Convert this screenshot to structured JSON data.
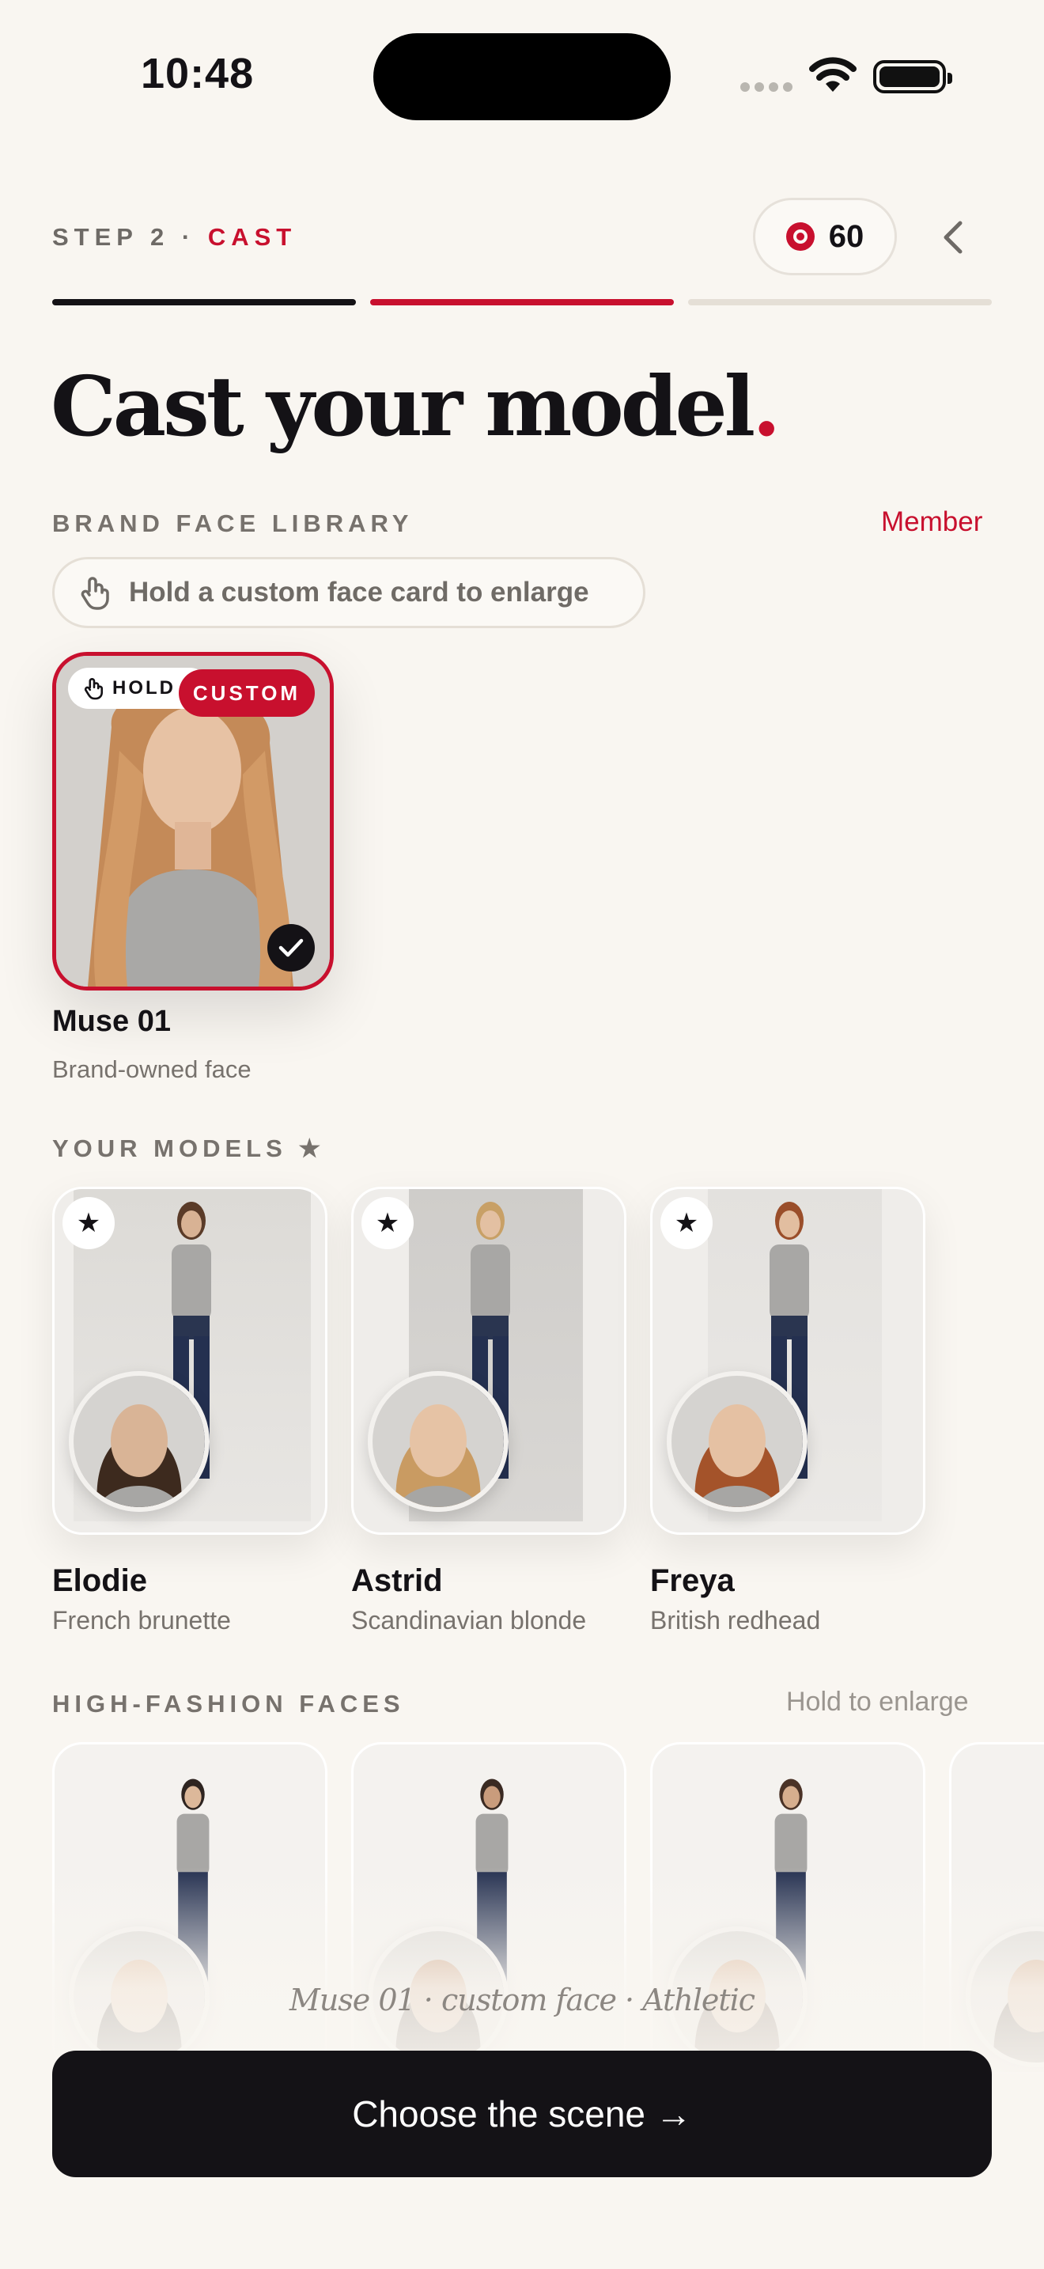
{
  "status_bar": {
    "time": "10:48"
  },
  "header": {
    "step_prefix": "STEP 2 · ",
    "step_name": "CAST",
    "credits": "60"
  },
  "title": {
    "text": "Cast your model",
    "dot": "."
  },
  "brand_library": {
    "label": "BRAND FACE LIBRARY",
    "membership": "Member",
    "hint": "Hold a custom face card to enlarge",
    "card": {
      "hold_badge": "HOLD",
      "custom_badge": "CUSTOM",
      "name": "Muse 01",
      "subtitle": "Brand-owned face"
    }
  },
  "your_models": {
    "label": "YOUR MODELS ★",
    "items": [
      {
        "name": "Elodie",
        "subtitle": "French brunette"
      },
      {
        "name": "Astrid",
        "subtitle": "Scandinavian blonde"
      },
      {
        "name": "Freya",
        "subtitle": "British redhead"
      }
    ]
  },
  "high_fashion": {
    "label": "HIGH-FASHION FACES",
    "hint": "Hold to enlarge"
  },
  "footer": {
    "caption": "Muse 01 · custom face · Athletic",
    "cta": "Choose the scene →"
  },
  "colors": {
    "accent": "#c8102e",
    "ink": "#141216",
    "background": "#f9f6f1"
  }
}
